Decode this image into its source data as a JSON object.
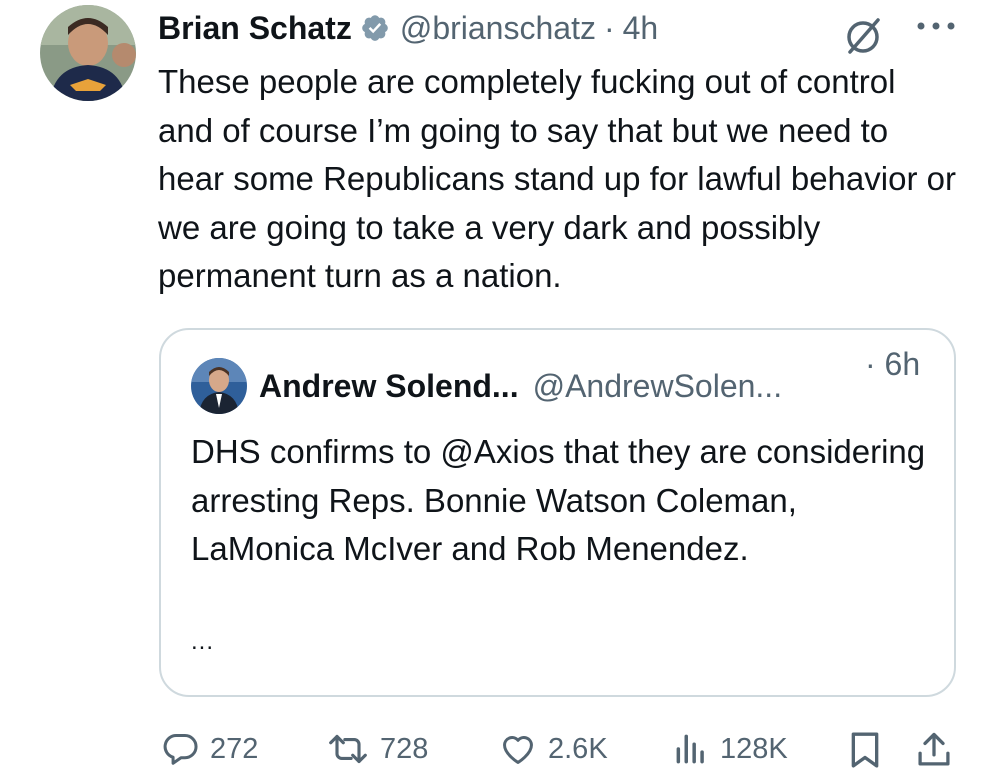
{
  "author": {
    "name": "Brian Schatz",
    "handle": "@brianschatz",
    "separator": "·",
    "time": "4h"
  },
  "tweet": {
    "text": "These people are completely fucking out of control and of course I’m going to say that but we need to hear some Republicans stand up for lawful behavior or we are going to take a very dark and possibly permanent turn as a nation."
  },
  "quoted": {
    "name": "Andrew Solend...",
    "handle": "@AndrewSolen...",
    "time": "· 6h",
    "text": "DHS confirms to @Axios that they are considering arresting Reps. Bonnie Watson Coleman, LaMonica McIver and Rob Menendez.",
    "ellipsis": "..."
  },
  "actions": {
    "replies": "272",
    "reposts": "728",
    "likes": "2.6K",
    "views": "128K"
  },
  "colors": {
    "text": "#0f1419",
    "secondary": "#536471",
    "verified": "#829aab",
    "border": "#cfd9de"
  },
  "icons": [
    "verified-badge-icon",
    "grok-icon",
    "more-icon",
    "reply-icon",
    "repost-icon",
    "like-icon",
    "views-icon",
    "bookmark-icon",
    "share-icon"
  ]
}
